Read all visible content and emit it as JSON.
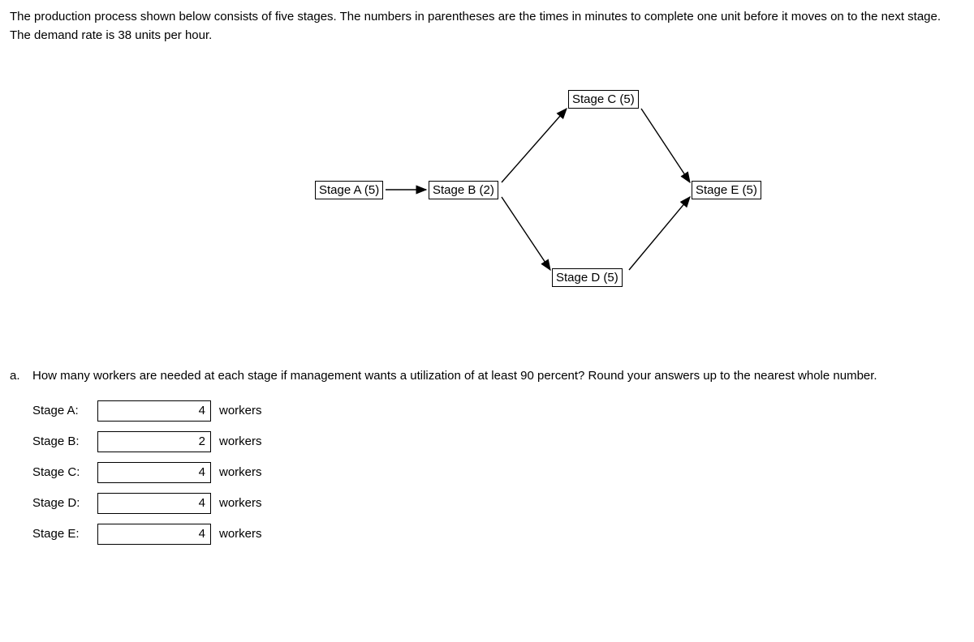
{
  "problem": {
    "intro": "The production process shown below consists of five stages. The numbers in parentheses are the times in minutes to complete one unit before it moves on to the next stage. The demand rate is 38 units per hour."
  },
  "diagram": {
    "stageA": "Stage A (5)",
    "stageB": "Stage B (2)",
    "stageC": "Stage C (5)",
    "stageD": "Stage D (5)",
    "stageE": "Stage E (5)"
  },
  "question": {
    "marker": "a.",
    "text": "How many workers are needed at each stage if management wants a utilization of at least 90 percent? Round your answers up to the nearest whole number."
  },
  "answers": {
    "unit": "workers",
    "rows": [
      {
        "label": "Stage A:",
        "value": "4"
      },
      {
        "label": "Stage B:",
        "value": "2"
      },
      {
        "label": "Stage C:",
        "value": "4"
      },
      {
        "label": "Stage D:",
        "value": "4"
      },
      {
        "label": "Stage E:",
        "value": "4"
      }
    ]
  }
}
